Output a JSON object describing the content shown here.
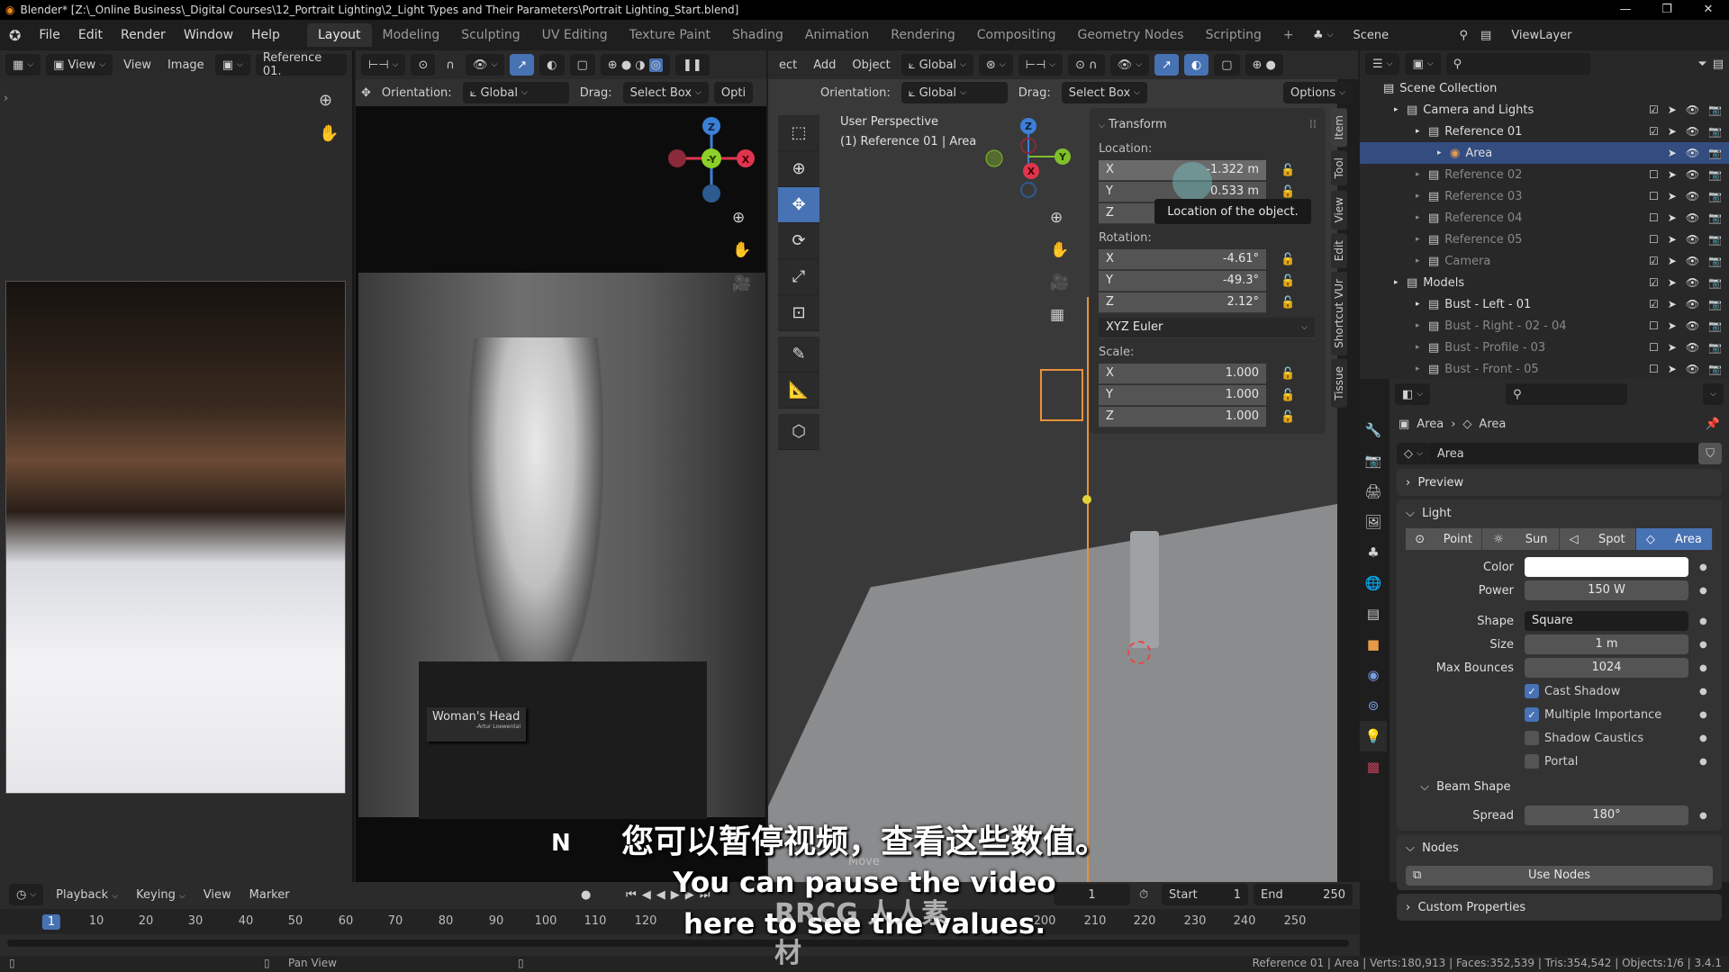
{
  "window": {
    "title": "Blender* [Z:\\_Online Business\\_Digital Courses\\12_Portrait Lighting\\2_Light Types and Their Parameters\\Portrait Lighting_Start.blend]",
    "controls": [
      "—",
      "❐",
      "✕"
    ]
  },
  "menubar": {
    "menus": [
      "File",
      "Edit",
      "Render",
      "Window",
      "Help"
    ],
    "workspaces": [
      "Layout",
      "Modeling",
      "Sculpting",
      "UV Editing",
      "Texture Paint",
      "Shading",
      "Animation",
      "Rendering",
      "Compositing",
      "Geometry Nodes",
      "Scripting"
    ],
    "active_workspace": "Layout",
    "add_tab": "+",
    "scene": "Scene",
    "view_layer": "ViewLayer"
  },
  "image_editor": {
    "view_menu": "View",
    "menus": [
      "View",
      "Image"
    ],
    "image_name": "Reference 01."
  },
  "camera_view": {
    "orientation_label": "Orientation:",
    "orientation": "Global",
    "drag_label": "Drag:",
    "drag": "Select Box",
    "options": "Opti",
    "plaque_title": "Woman's Head",
    "plaque_author": "-Artur Loewental",
    "gizmo": {
      "z": "Z",
      "y": "-Y",
      "x": "X"
    }
  },
  "viewport": {
    "menus": [
      "ect",
      "Add",
      "Object"
    ],
    "transform_orientation": "Global",
    "orientation_label": "Orientation:",
    "orientation": "Global",
    "drag_label": "Drag:",
    "drag": "Select Box",
    "options": "Options",
    "info_line1": "User Perspective",
    "info_line2": "(1) Reference 01 | Area",
    "gizmo": {
      "z": "Z",
      "y": "Y",
      "x": "X"
    }
  },
  "transform_panel": {
    "title": "Transform",
    "location_label": "Location:",
    "location": [
      {
        "axis": "X",
        "value": "-1.322 m"
      },
      {
        "axis": "Y",
        "value": "0.533 m"
      },
      {
        "axis": "Z",
        "value": ""
      }
    ],
    "rotation_label": "Rotation:",
    "rotation": [
      {
        "axis": "X",
        "value": "-4.61°"
      },
      {
        "axis": "Y",
        "value": "-49.3°"
      },
      {
        "axis": "Z",
        "value": "2.12°"
      }
    ],
    "rotation_mode": "XYZ Euler",
    "scale_label": "Scale:",
    "scale": [
      {
        "axis": "X",
        "value": "1.000"
      },
      {
        "axis": "Y",
        "value": "1.000"
      },
      {
        "axis": "Z",
        "value": "1.000"
      }
    ],
    "tooltip": "Location of the object."
  },
  "sidebar_tabs": [
    "Item",
    "Tool",
    "View",
    "Edit",
    "Shortcut VUr",
    "Tissue"
  ],
  "outliner": {
    "root": "Scene Collection",
    "items": [
      {
        "label": "Camera and Lights",
        "indent": 1,
        "checked": true,
        "dim": false
      },
      {
        "label": "Reference 01",
        "indent": 2,
        "checked": true,
        "dim": false
      },
      {
        "label": "Area",
        "indent": 3,
        "checked": null,
        "dim": false,
        "selected": true
      },
      {
        "label": "Reference 02",
        "indent": 2,
        "checked": false,
        "dim": true
      },
      {
        "label": "Reference 03",
        "indent": 2,
        "checked": false,
        "dim": true
      },
      {
        "label": "Reference 04",
        "indent": 2,
        "checked": false,
        "dim": true
      },
      {
        "label": "Reference 05",
        "indent": 2,
        "checked": false,
        "dim": true
      },
      {
        "label": "Camera",
        "indent": 2,
        "checked": true,
        "dim": true
      },
      {
        "label": "Models",
        "indent": 1,
        "checked": true,
        "dim": false
      },
      {
        "label": "Bust - Left - 01",
        "indent": 2,
        "checked": true,
        "dim": false
      },
      {
        "label": "Bust - Right - 02 - 04",
        "indent": 2,
        "checked": false,
        "dim": true
      },
      {
        "label": "Bust - Profile - 03",
        "indent": 2,
        "checked": false,
        "dim": true
      },
      {
        "label": "Bust - Front - 05",
        "indent": 2,
        "checked": false,
        "dim": true
      }
    ]
  },
  "properties": {
    "breadcrumb": [
      "Area",
      "Area"
    ],
    "datablock_name": "Area",
    "preview_label": "Preview",
    "light_label": "Light",
    "light_types": [
      "Point",
      "Sun",
      "Spot",
      "Area"
    ],
    "active_light_type": "Area",
    "color_label": "Color",
    "color_value": "#ffffff",
    "power_label": "Power",
    "power": "150 W",
    "shape_label": "Shape",
    "shape": "Square",
    "size_label": "Size",
    "size": "1 m",
    "max_bounces_label": "Max Bounces",
    "max_bounces": "1024",
    "checkboxes": [
      {
        "label": "Cast Shadow",
        "checked": true
      },
      {
        "label": "Multiple Importance",
        "checked": true
      },
      {
        "label": "Shadow Caustics",
        "checked": false
      },
      {
        "label": "Portal",
        "checked": false
      }
    ],
    "beam_shape_label": "Beam Shape",
    "spread_label": "Spread",
    "spread": "180°",
    "nodes_label": "Nodes",
    "use_nodes": "Use Nodes",
    "custom_properties": "Custom Properties"
  },
  "timeline": {
    "menus": [
      "Playback",
      "Keying",
      "View",
      "Marker"
    ],
    "current_frame": "1",
    "start_label": "Start",
    "start": "1",
    "end_label": "End",
    "end": "250",
    "ticks": [
      "1",
      "10",
      "20",
      "30",
      "40",
      "50",
      "60",
      "70",
      "80",
      "90",
      "100",
      "110",
      "120",
      "200",
      "210",
      "220",
      "230",
      "240",
      "250"
    ]
  },
  "statusbar": {
    "hint": "Pan View",
    "stats": "Reference 01 | Area | Verts:180,913 | Faces:352,539 | Tris:354,542 | Objects:1/6 | 3.4.1"
  },
  "overlay": {
    "key_pressed": "N",
    "operator": "Move",
    "subtitle_cn": "您可以暂停视频，查看这些数值。",
    "subtitle_en_1": "You can pause the video",
    "subtitle_en_2": "here to see the values.",
    "watermark": "RRCG 人人素材"
  },
  "colors": {
    "accent": "#4772b3",
    "selection": "#334d80",
    "x_axis": "#e0354e",
    "y_axis": "#7fbf2a",
    "z_axis": "#3b7fd8"
  }
}
